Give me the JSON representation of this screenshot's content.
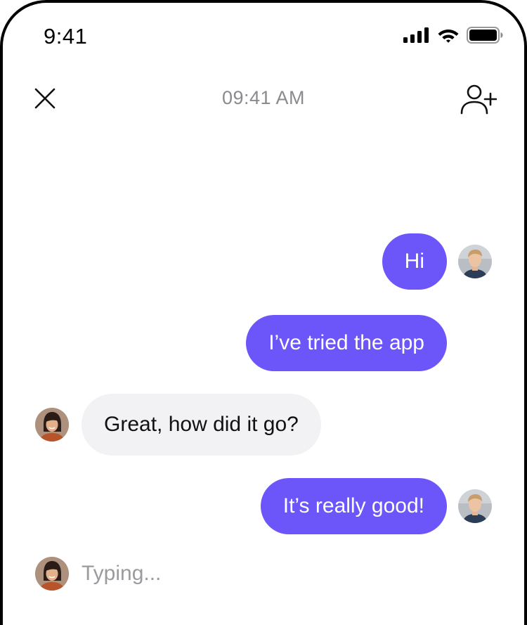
{
  "status_bar": {
    "time": "9:41"
  },
  "header": {
    "timestamp": "09:41 AM"
  },
  "messages": [
    {
      "sender": "me",
      "text": "Hi"
    },
    {
      "sender": "me",
      "text": "I’ve tried the app"
    },
    {
      "sender": "other",
      "text": "Great, how did it go?"
    },
    {
      "sender": "me",
      "text": "It’s really good!"
    }
  ],
  "typing": {
    "text": "Typing..."
  },
  "colors": {
    "outgoing_bubble": "#6c55f9",
    "incoming_bubble": "#f2f2f4",
    "muted_text": "#8a8a8f"
  },
  "icons": {
    "close": "close-icon",
    "add_user": "add-user-icon",
    "signal": "cellular-signal-icon",
    "wifi": "wifi-icon",
    "battery": "battery-icon"
  }
}
